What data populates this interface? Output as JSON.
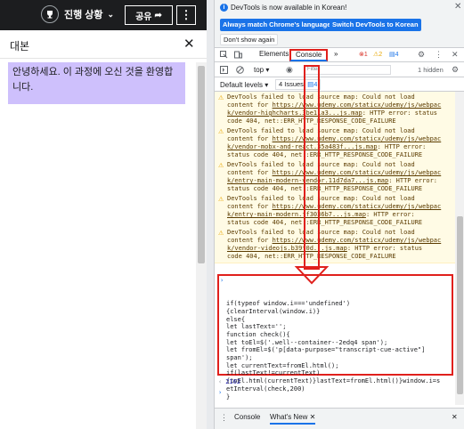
{
  "course_header": {
    "progress_label": "진행 상황",
    "share_label": "공유",
    "more_label": "⋮"
  },
  "transcript": {
    "title": "대본",
    "close_label": "✕",
    "cue_text": "안녕하세요. 이 과정에 오신 것을 환영합니다."
  },
  "devtools": {
    "info": {
      "message": "DevTools is now available in Korean!",
      "match_button": "Always match Chrome's language",
      "switch_button": "Switch DevTools to Korean",
      "dont_show_button": "Don't show again"
    },
    "tabs": {
      "elements": "Elements",
      "console": "Console",
      "more": "»"
    },
    "badges": {
      "errors": "1",
      "warnings": "2",
      "issues": "4"
    },
    "filter": {
      "context": "top ▾",
      "placeholder": "Filter",
      "hidden": "1 hidden"
    },
    "level": {
      "default_levels": "Default levels ▾",
      "issues_label": "4 Issues:",
      "issues_count": "4"
    },
    "warnings": [
      {
        "lines": [
          "DevTools failed to load source map: Could not load",
          "content for ",
          "https://www.udemy.com/staticx/udemy/js/webpac",
          "k/vendor-highcharts.3be11a3...js.map",
          ": HTTP error: status",
          "code 404, net::ERR_HTTP_RESPONSE_CODE_FAILURE"
        ]
      },
      {
        "lines": [
          "DevTools failed to load source map: Could not load",
          "content for ",
          "https://www.udemy.com/staticx/udemy/js/webpac",
          "k/vendor-mobx-and-react.35a483f...js.map",
          ": HTTP error:",
          "status code 404, net::ERR_HTTP_RESPONSE_CODE_FAILURE"
        ]
      },
      {
        "lines": [
          "DevTools failed to load source map: Could not load",
          "content for ",
          "https://www.udemy.com/staticx/udemy/js/webpac",
          "k/entry-main-modern-vendor.11d7da7...js.map",
          ": HTTP error:",
          "status code 404, net::ERR_HTTP_RESPONSE_CODE_FAILURE"
        ]
      },
      {
        "lines": [
          "DevTools failed to load source map: Could not load",
          "content for ",
          "https://www.udemy.com/staticx/udemy/js/webpac",
          "k/entry-main-modern.ff3036b7...js.map",
          ": HTTP error:",
          "status code 404, net::ERR_HTTP_RESPONSE_CODE_FAILURE"
        ]
      },
      {
        "lines": [
          "DevTools failed to load source map: Could not load",
          "content for ",
          "https://www.udemy.com/staticx/udemy/js/webpac",
          "k/vendor-videojs.b39f0d...js.map",
          ": HTTP error: status",
          "code 404, net::ERR_HTTP_RESPONSE_CODE_FAILURE"
        ]
      }
    ],
    "code_lines": [
      "if(typeof window.i==='undefined')",
      "{clearInterval(window.i)}",
      "else{",
      "let lastText='';",
      "function check(){",
      "let toEl=$('.well--container--2edq4 span');",
      "let fromEl=$('p[data-purpose=\"transcript-cue-active\"]",
      "span');",
      "let currentText=fromEl.html();",
      "if(lastText!=currentText)",
      "{toEl.html(currentText)}lastText=fromEl.html()}window.i=s",
      "etInterval(check,200)",
      "}"
    ],
    "result_value": "2162",
    "drawer": {
      "console_tab": "Console",
      "whats_new_tab": "What's New",
      "close": "✕"
    }
  },
  "colors": {
    "header_bg": "#1c1d1f",
    "cue_highlight": "#cec0fc",
    "annotation_red": "#e0201c",
    "accent_blue": "#1a73e8",
    "warning_bg": "#fffbe5"
  }
}
